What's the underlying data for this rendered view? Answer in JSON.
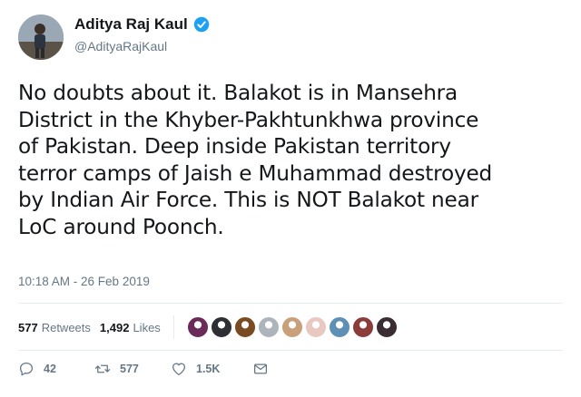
{
  "author": {
    "display_name": "Aditya Raj Kaul",
    "handle": "@AdityaRajKaul",
    "verified": true
  },
  "tweet": {
    "lines": [
      "No doubts about it. Balakot is in Mansehra",
      "District in the Khyber-Pakhtunkhwa province",
      "of Pakistan. Deep inside Pakistan territory",
      "terror camps of Jaish e Muhammad destroyed",
      "by Indian Air Force. This is NOT Balakot near",
      "LoC around Poonch."
    ],
    "timestamp": "10:18 AM - 26 Feb 2019"
  },
  "stats": {
    "retweets": {
      "count": "577",
      "label": "Retweets"
    },
    "likes": {
      "count": "1,492",
      "label": "Likes"
    }
  },
  "liker_avatars": [
    {
      "color": "#6b2a5a"
    },
    {
      "color": "#2d2f33"
    },
    {
      "color": "#7a4a22"
    },
    {
      "color": "#aeb4bb"
    },
    {
      "color": "#c9a07a"
    },
    {
      "color": "#e8c8c0"
    },
    {
      "color": "#5e8fb5"
    },
    {
      "color": "#8c3b3b"
    },
    {
      "color": "#3a2c33"
    }
  ],
  "actions": {
    "reply_count": "42",
    "retweet_count": "577",
    "like_count": "1.5K"
  },
  "colors": {
    "verified_blue": "#1da1f2",
    "secondary_text": "#657786",
    "primary_text": "#14171a"
  }
}
